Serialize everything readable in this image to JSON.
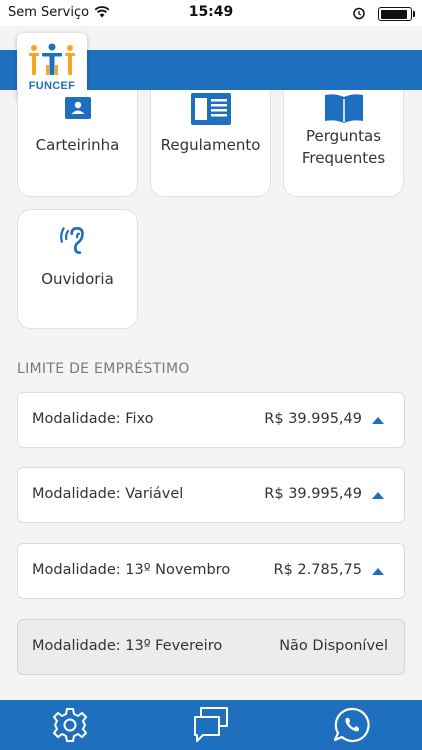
{
  "status_bar": {
    "carrier": "Sem Serviço",
    "time": "15:49",
    "battery_level": 0.92,
    "icons": [
      "wifi-icon",
      "alarm-icon",
      "battery-icon"
    ]
  },
  "header": {
    "logo_text": "FUNCEF",
    "brand_color": "#1f6fbf",
    "logo_accent": "#f5a623"
  },
  "shortcuts": [
    {
      "label": "Carteirinha",
      "icon": "id-card-icon"
    },
    {
      "label": "Regulamento",
      "icon": "document-icon"
    },
    {
      "label_lines": [
        "Perguntas",
        "Frequentes"
      ],
      "icon": "book-icon"
    },
    {
      "label": "Ouvidoria",
      "icon": "ear-icon"
    }
  ],
  "loan_section": {
    "title": "LIMITE DE EMPRÉSTIMO",
    "rows": [
      {
        "label": "Modalidade: Fixo",
        "value": "R$ 39.995,49",
        "available": true
      },
      {
        "label": "Modalidade: Variável",
        "value": "R$ 39.995,49",
        "available": true
      },
      {
        "label": "Modalidade: 13º Novembro",
        "value": "R$ 2.785,75",
        "available": true
      },
      {
        "label": "Modalidade: 13º Fevereiro",
        "value": "Não Disponível",
        "available": false
      }
    ]
  },
  "bottom_bar": {
    "items": [
      "gear-icon",
      "chat-icon",
      "whatsapp-icon"
    ]
  }
}
